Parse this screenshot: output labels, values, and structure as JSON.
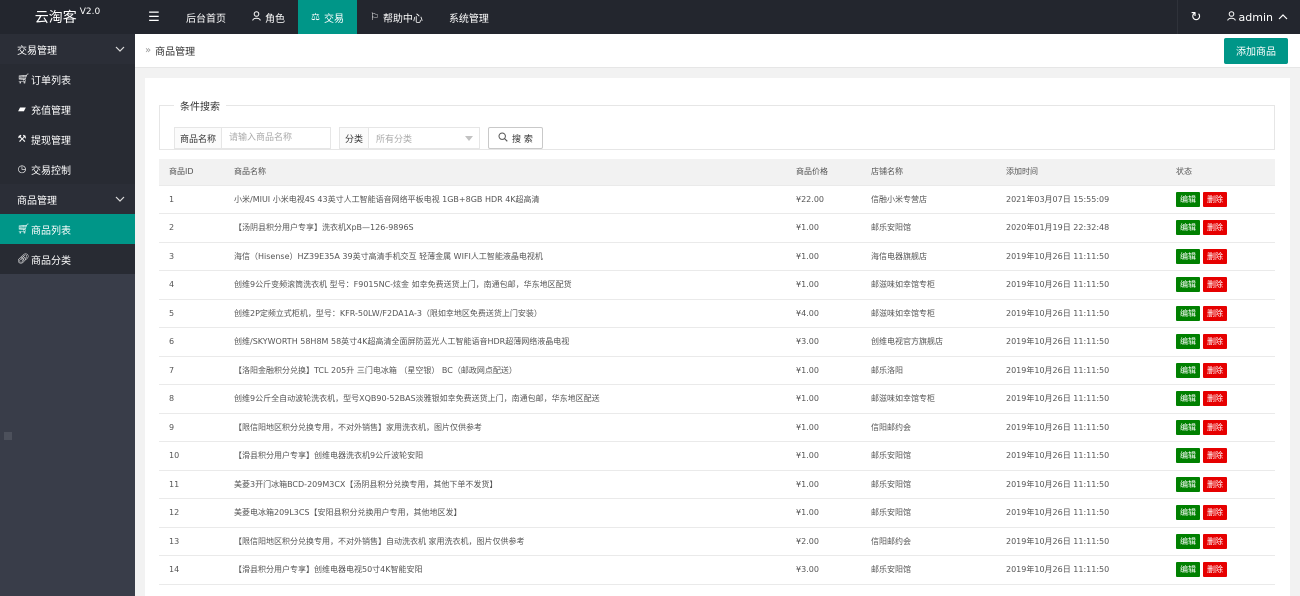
{
  "app": {
    "logo": "云淘客",
    "version": "V2.0"
  },
  "topnav": {
    "items": [
      {
        "label": "后台首页",
        "icon": ""
      },
      {
        "label": "角色",
        "icon": "user-icon"
      },
      {
        "label": "交易",
        "icon": "scale-icon",
        "active": true
      },
      {
        "label": "帮助中心",
        "icon": "flag-icon"
      },
      {
        "label": "系统管理",
        "icon": ""
      }
    ],
    "user": "admin"
  },
  "sidebar": {
    "groups": [
      {
        "label": "交易管理",
        "items": [
          {
            "label": "订单列表",
            "icon": "cart-icon"
          },
          {
            "label": "充值管理",
            "icon": "chat-icon"
          },
          {
            "label": "提现管理",
            "icon": "hammer-icon"
          },
          {
            "label": "交易控制",
            "icon": "clock-icon"
          }
        ]
      },
      {
        "label": "商品管理",
        "items": [
          {
            "label": "商品列表",
            "icon": "cart-icon",
            "active": true
          },
          {
            "label": "商品分类",
            "icon": "link-icon"
          }
        ]
      }
    ]
  },
  "breadcrumb": {
    "label": "商品管理"
  },
  "actions": {
    "add_label": "添加商品"
  },
  "search": {
    "legend": "条件搜索",
    "name_label": "商品名称",
    "name_placeholder": "请输入商品名称",
    "category_label": "分类",
    "category_value": "所有分类",
    "button_label": "搜 索"
  },
  "table": {
    "headers": [
      "商品ID",
      "商品名称",
      "商品价格",
      "店铺名称",
      "添加时间",
      "状态"
    ],
    "edit_label": "编辑",
    "delete_label": "删除",
    "rows": [
      {
        "id": "1",
        "name": "小米/MIUI 小米电视4S 43英寸人工智能语音网络平板电视 1GB+8GB HDR 4K超高清",
        "price": "¥22.00",
        "shop": "信融小米专营店",
        "time": "2021年03月07日 15:55:09"
      },
      {
        "id": "2",
        "name": "【汤阴县积分用户专享】洗衣机XpB—126-9896S",
        "price": "¥1.00",
        "shop": "邮乐安阳馆",
        "time": "2020年01月19日 22:32:48"
      },
      {
        "id": "3",
        "name": "海信（Hisense）HZ39E35A 39英寸高清手机交互 轻薄金属 WIFI人工智能液晶电视机",
        "price": "¥1.00",
        "shop": "海信电器旗舰店",
        "time": "2019年10月26日 11:11:50"
      },
      {
        "id": "4",
        "name": "创维9公斤变频滚筒洗衣机 型号：F9015NC-炫金 如幸免费送货上门，南通包邮，华东地区配货",
        "price": "¥1.00",
        "shop": "邮滋味如幸馆专柜",
        "time": "2019年10月26日 11:11:50"
      },
      {
        "id": "5",
        "name": "创维2P定频立式柜机，型号：KFR-50LW/F2DA1A-3（限如幸地区免费送货上门安装）",
        "price": "¥4.00",
        "shop": "邮滋味如幸馆专柜",
        "time": "2019年10月26日 11:11:50"
      },
      {
        "id": "6",
        "name": "创维/SKYWORTH 58H8M 58英寸4K超高清全面屏防蓝光人工智能语音HDR超薄网络液晶电视",
        "price": "¥3.00",
        "shop": "创维电视官方旗舰店",
        "time": "2019年10月26日 11:11:50"
      },
      {
        "id": "7",
        "name": "【洛阳金融积分兑换】TCL 205升 三门电冰箱 （星空银） BC（邮政网点配送）",
        "price": "¥1.00",
        "shop": "邮乐洛阳",
        "time": "2019年10月26日 11:11:50"
      },
      {
        "id": "8",
        "name": "创维9公斤全自动波轮洗衣机，型号XQB90-52BAS淡雅银如幸免费送货上门，南通包邮，华东地区配送",
        "price": "¥1.00",
        "shop": "邮滋味如幸馆专柜",
        "time": "2019年10月26日 11:11:50"
      },
      {
        "id": "9",
        "name": "【限信阳地区积分兑换专用，不对外销售】家用洗衣机，图片仅供参考",
        "price": "¥1.00",
        "shop": "信阳邮约会",
        "time": "2019年10月26日 11:11:50"
      },
      {
        "id": "10",
        "name": "【滑县积分用户专享】创维电器洗衣机9公斤波轮安阳",
        "price": "¥1.00",
        "shop": "邮乐安阳馆",
        "time": "2019年10月26日 11:11:50"
      },
      {
        "id": "11",
        "name": "美菱3开门冰箱BCD-209M3CX【汤阴县积分兑换专用，其他下单不发货】",
        "price": "¥1.00",
        "shop": "邮乐安阳馆",
        "time": "2019年10月26日 11:11:50"
      },
      {
        "id": "12",
        "name": "美菱电冰箱209L3CS【安阳县积分兑换用户专用，其他地区发】",
        "price": "¥1.00",
        "shop": "邮乐安阳馆",
        "time": "2019年10月26日 11:11:50"
      },
      {
        "id": "13",
        "name": "【限信阳地区积分兑换专用，不对外销售】自动洗衣机 家用洗衣机，图片仅供参考",
        "price": "¥2.00",
        "shop": "信阳邮约会",
        "time": "2019年10月26日 11:11:50"
      },
      {
        "id": "14",
        "name": "【滑县积分用户专享】创维电器电视50寸4K智能安阳",
        "price": "¥3.00",
        "shop": "邮乐安阳馆",
        "time": "2019年10月26日 11:11:50"
      }
    ]
  }
}
